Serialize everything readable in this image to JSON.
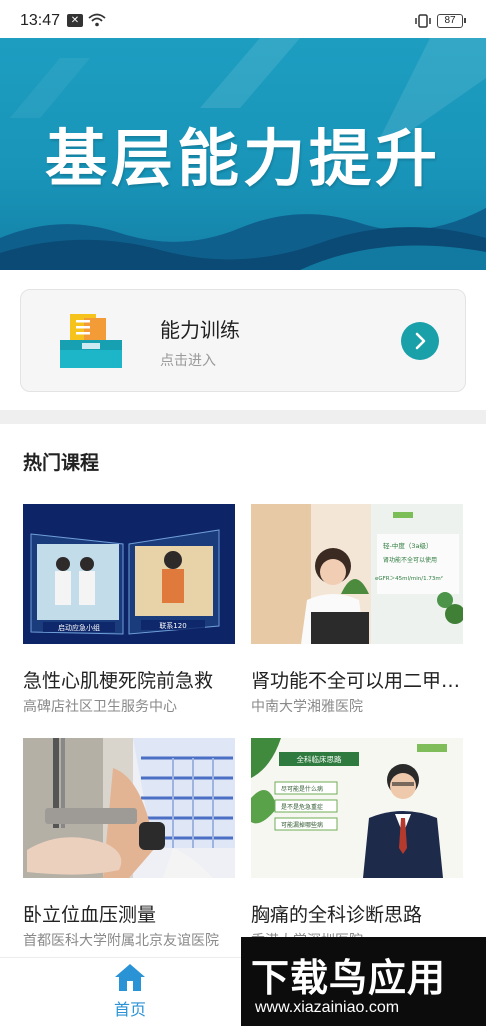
{
  "status_bar": {
    "time": "13:47",
    "battery": "87"
  },
  "banner": {
    "title": "基层能力提升"
  },
  "training_card": {
    "title": "能力训练",
    "subtitle": "点击进入"
  },
  "hot_courses": {
    "title": "热门课程",
    "items": [
      {
        "title": "急性心肌梗死院前急救",
        "source": "高碑店社区卫生服务中心",
        "thumb_caption_left": "启动应急小组",
        "thumb_caption_right": "联系120"
      },
      {
        "title": "肾功能不全可以用二甲双胍吗",
        "source": "中南大学湘雅医院",
        "thumb_slide_heading": "轻-中度（3a级）",
        "thumb_slide_line1": "肾功能不全可以使用",
        "thumb_slide_line2": "eGFR＞45ml/min/1.73m²"
      },
      {
        "title": "卧立位血压测量",
        "source": "首都医科大学附属北京友谊医院"
      },
      {
        "title": "胸痛的全科诊断思路",
        "source": "香港大学深圳医院",
        "thumb_slide_heading": "全科临床思路",
        "thumb_slide_items": [
          "尽可能是什么病",
          "是不是危急重症",
          "可能漏掉哪些病"
        ]
      }
    ]
  },
  "bottom_nav": {
    "home_label": "首页"
  },
  "watermark": {
    "brand": "下载鸟应用",
    "url": "www.xiazainiao.com"
  },
  "colors": {
    "banner": "#1d9ec1",
    "accent_teal": "#1aa0a9",
    "nav_active": "#2a93d5"
  }
}
